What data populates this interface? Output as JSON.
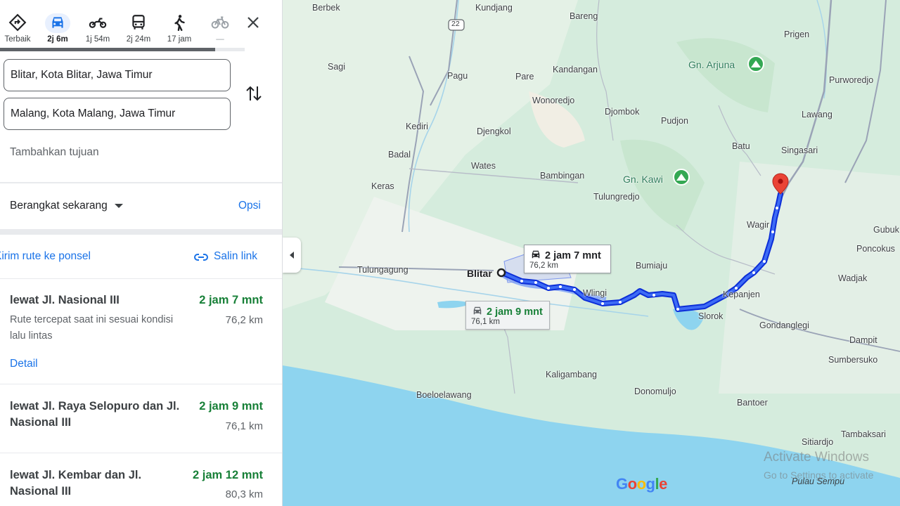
{
  "modes": [
    {
      "name": "best",
      "label": "Terbaik"
    },
    {
      "name": "car",
      "label": "2j 6m"
    },
    {
      "name": "motorcycle",
      "label": "1j 54m"
    },
    {
      "name": "transit",
      "label": "2j 24m"
    },
    {
      "name": "walk",
      "label": "17 jam"
    },
    {
      "name": "bicycle",
      "label": "—"
    }
  ],
  "active_mode": "car",
  "modes_scroll_progress": 0.88,
  "origin": "Blitar, Kota Blitar, Jawa Timur",
  "destination": "Malang, Kota Malang, Jawa Timur",
  "add_destination": "Tambahkan tujuan",
  "depart_label": "Berangkat sekarang",
  "options_label": "Opsi",
  "send_to_phone": "Kirim rute ke ponsel",
  "copy_link": "Salin link",
  "routes": [
    {
      "name": "lewat Jl. Nasional III",
      "duration": "2 jam 7 mnt",
      "distance": "76,2 km",
      "desc": "Rute tercepat saat ini sesuai kondisi lalu lintas",
      "detail": "Detail"
    },
    {
      "name": "lewat Jl. Raya Selopuro dan Jl. Nasional III",
      "duration": "2 jam 9 mnt",
      "distance": "76,1 km"
    },
    {
      "name": "lewat Jl. Kembar dan Jl. Nasional III",
      "duration": "2 jam 12 mnt",
      "distance": "80,3 km"
    }
  ],
  "map": {
    "places": [
      "Berbek",
      "Kundjang",
      "Bareng",
      "Prigen",
      "Sagi",
      "Pagu",
      "Pare",
      "Kandangan",
      "Purworedjo",
      "Wonoredjo",
      "Djombok",
      "Pudjon",
      "Lawang",
      "Kediri",
      "Djengkol",
      "Batu",
      "Singasari",
      "Badal",
      "Wates",
      "Bambingan",
      "Keras",
      "Tulungredjo",
      "Wagir",
      "Gubuk",
      "Poncokus",
      "Tulungagung",
      "Bumiaju",
      "Wadjak",
      "Wlingi",
      "Kepanjen",
      "Slorok",
      "Gondanglegi",
      "Dampit",
      "Sumbersuko",
      "Kaligambang",
      "Boeloelawang",
      "Donomuljo",
      "Bantoer",
      "Sitiardjo",
      "Tambaksari"
    ],
    "peaks": [
      "Gn. Arjuna",
      "Gn. Kawi"
    ],
    "road_shield": "22",
    "origin_label": "Blitar",
    "callout_main": {
      "time": "2 jam 7 mnt",
      "distance": "76,2 km"
    },
    "callout_alt": {
      "time": "2 jam 9 mnt",
      "distance": "76,1 km"
    },
    "pulau": "Pulau Sempu",
    "watermark": "Activate Windows",
    "watermark_sub": "Go to Settings to activate"
  },
  "colors": {
    "route": "#1a47e0",
    "accent": "#1a73e8",
    "duration": "#188038",
    "sea": "#8ed4ef",
    "land": "#d5ecdd"
  },
  "google_logo": "Google"
}
